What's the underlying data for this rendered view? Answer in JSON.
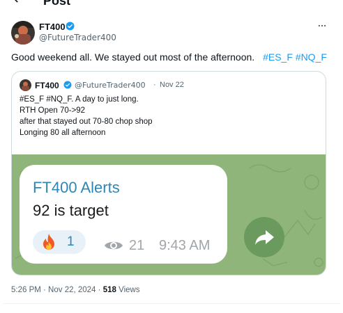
{
  "header": {
    "title": "Post"
  },
  "post": {
    "author_name": "FT400",
    "author_handle": "@FutureTrader400",
    "text": "Good weekend all. We stayed out most of the afternoon.",
    "hashtags": [
      "#ES_F",
      "#NQ_F"
    ],
    "timestamp": "5:26 PM · Nov 22, 2024",
    "separator": "·",
    "views_count": "518",
    "views_label": "Views"
  },
  "quote": {
    "author_name": "FT400",
    "author_handle": "@FutureTrader400",
    "separator": "·",
    "date": "Nov 22",
    "lines": [
      "#ES_F #NQ_F. A day to just long.",
      "RTH Open 70->92",
      "after that stayed out 70-80 chop shop",
      "Longing 80 all afternoon"
    ]
  },
  "media": {
    "alert_title": "FT400 Alerts",
    "alert_message": "92 is target",
    "reaction_count": "1",
    "view_count": "21",
    "time": "9:43 AM"
  },
  "icons": {
    "verified": "verified-badge-icon",
    "more": "more-icon",
    "back": "back-arrow-icon",
    "fire": "fire-icon",
    "eye": "eye-icon",
    "forward": "forward-arrow-icon"
  },
  "colors": {
    "accent": "#1d9bf0",
    "telegram_bg": "#8fb57a",
    "alert_title": "#2f86b3"
  }
}
